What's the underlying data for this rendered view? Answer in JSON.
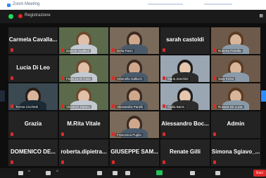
{
  "window": {
    "title": "Zoom Meeting"
  },
  "meeting": {
    "recording_label": "Registrazione"
  },
  "tiles": [
    {
      "big": "Carmela  Cavalla...",
      "label": "",
      "video": false
    },
    {
      "big": "",
      "label": "Daniela Gualtieri",
      "video": true
    },
    {
      "big": "",
      "label": "Delia Pacin",
      "video": true
    },
    {
      "big": "sarah castoldi",
      "label": "",
      "video": false
    },
    {
      "big": "",
      "label": "Roberta Petrella",
      "video": true
    },
    {
      "big": "Lucia Di Leo",
      "label": "",
      "video": false
    },
    {
      "big": "",
      "label": "Federica Di Gioia",
      "video": true
    },
    {
      "big": "",
      "label": "Antonella Galluzzi",
      "video": true
    },
    {
      "big": "",
      "label": "Maria Zanchini",
      "video": true,
      "active": true
    },
    {
      "big": "",
      "label": "Sara Kristo",
      "video": true
    },
    {
      "big": "",
      "label": "Teresa Cicchetti",
      "video": true
    },
    {
      "big": "",
      "label": "Vincenzo Saraco",
      "video": true
    },
    {
      "big": "",
      "label": "Alessandra Panelli",
      "video": true
    },
    {
      "big": "",
      "label": "Giulia Barra",
      "video": true
    },
    {
      "big": "",
      "label": "Rosaria De Lucia",
      "video": true
    },
    {
      "big": "Grazia",
      "label": "",
      "video": false
    },
    {
      "big": "M.Rita Vitale",
      "label": "",
      "video": false
    },
    {
      "big": "",
      "label": "Francesca Puglia",
      "video": true
    },
    {
      "big": "Alessandro  Boc...",
      "label": "",
      "video": false
    },
    {
      "big": "Admin",
      "label": "",
      "video": false
    },
    {
      "big": "DOMENICO  DE...",
      "label": "",
      "video": false
    },
    {
      "big": "roberta.dipietra...",
      "label": "",
      "video": false
    },
    {
      "big": "GIUSEPPE  SAM...",
      "label": "",
      "video": false
    },
    {
      "big": "Renate Gilli",
      "label": "",
      "video": false
    },
    {
      "big": "Simona  Sgiavo_...",
      "label": "",
      "video": false
    }
  ],
  "toolbar": {
    "end_label": "Esci"
  }
}
